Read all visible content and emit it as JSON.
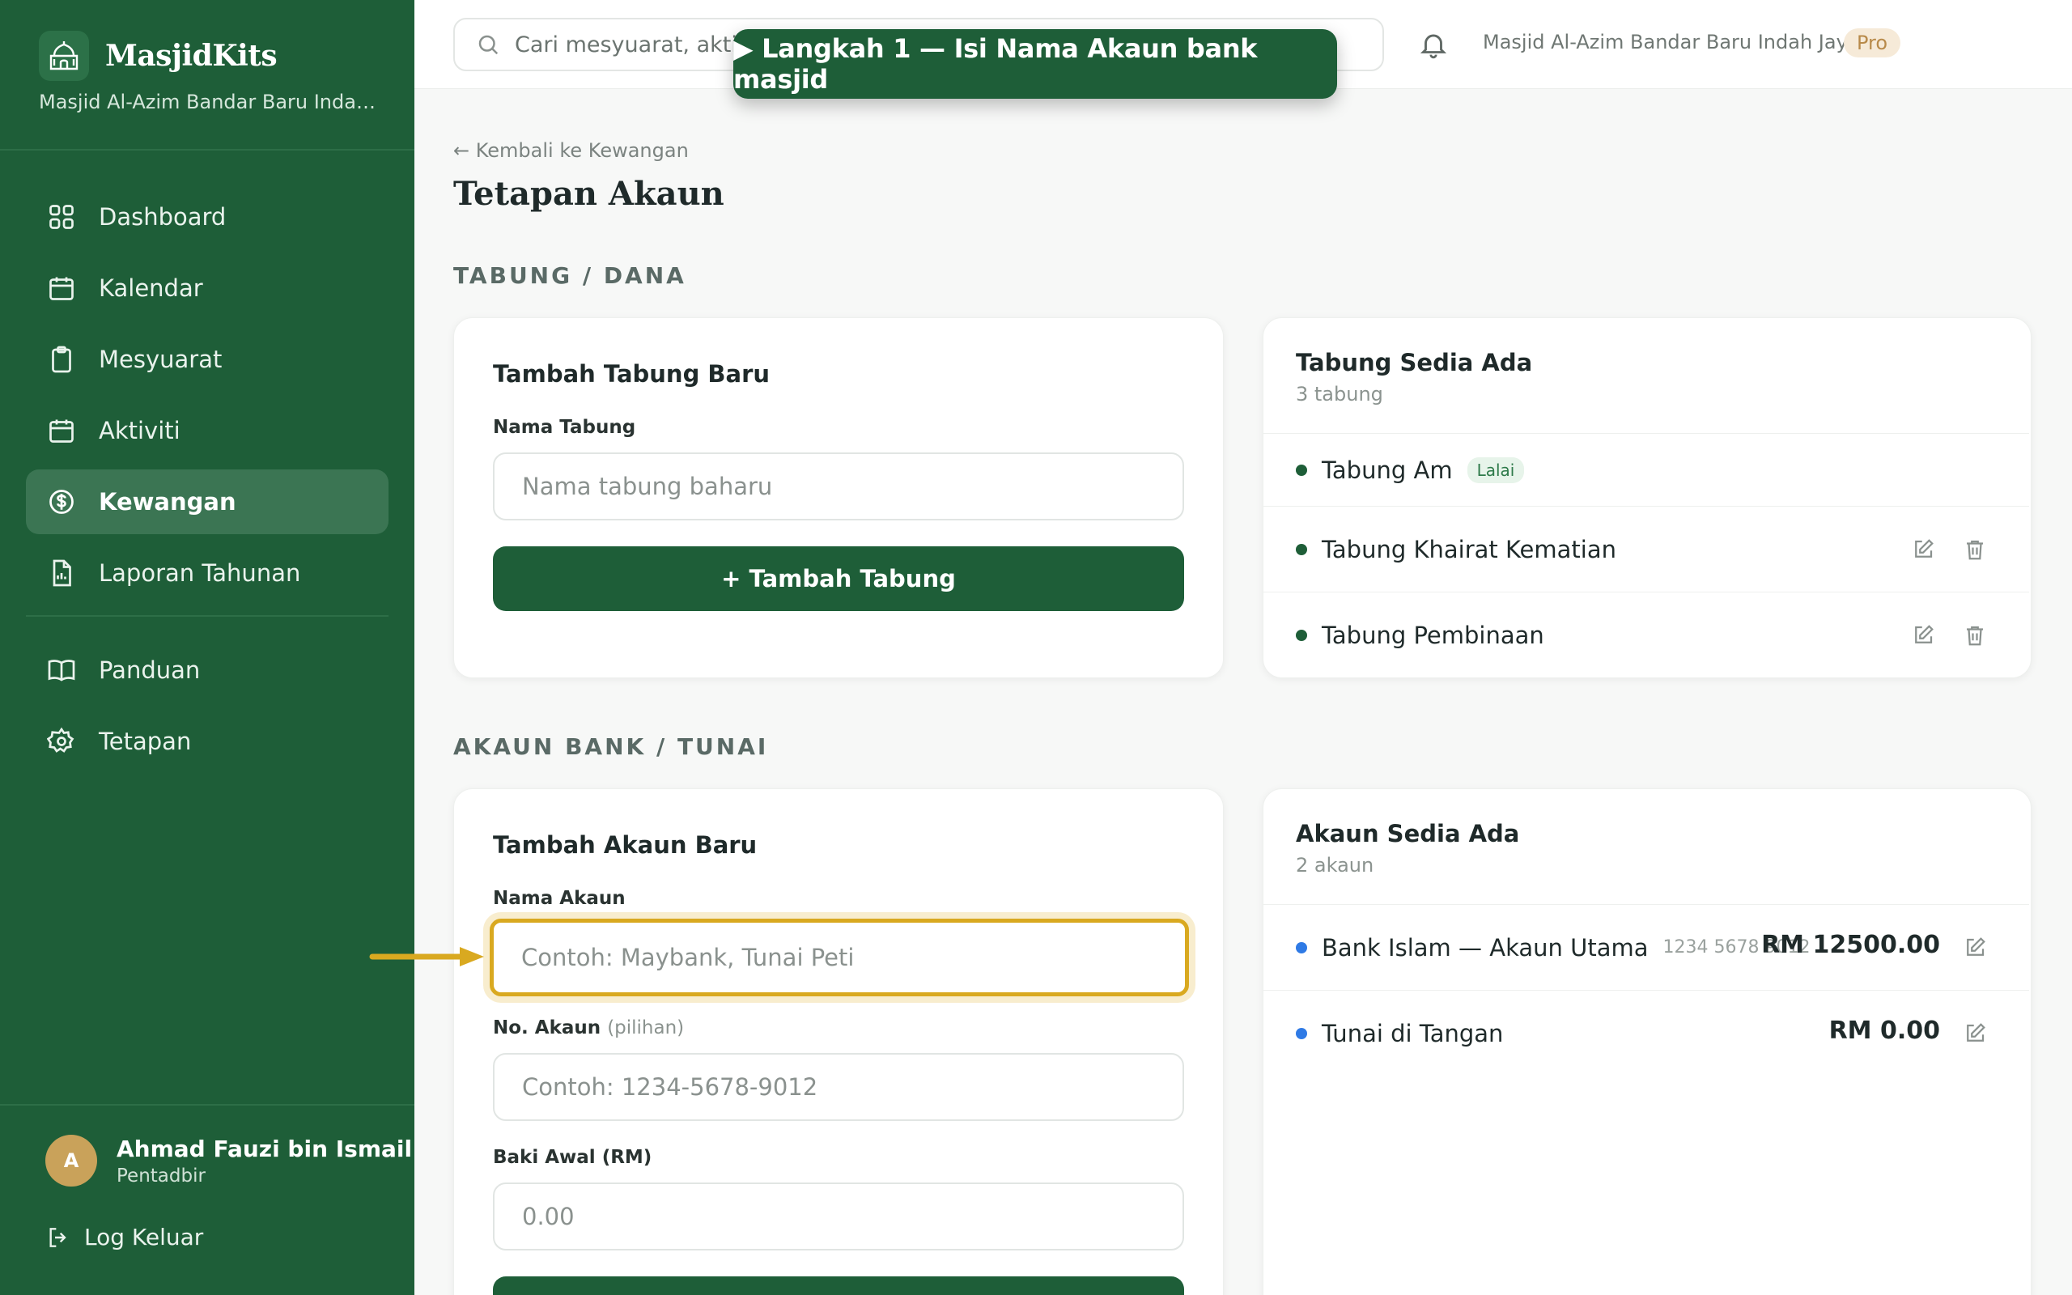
{
  "app": {
    "name": "MasjidKits",
    "mosque_name_short": "Masjid Al-Azim Bandar Baru Indah J...",
    "logo_icon": "mosque-icon",
    "accent": "#1e5e38",
    "highlight": "#d9a920"
  },
  "sidebar": {
    "items": [
      {
        "label": "Dashboard",
        "icon": "grid-icon"
      },
      {
        "label": "Kalendar",
        "icon": "calendar-icon"
      },
      {
        "label": "Mesyuarat",
        "icon": "clipboard-icon"
      },
      {
        "label": "Aktiviti",
        "icon": "calendar-icon"
      },
      {
        "label": "Kewangan",
        "icon": "dollar-icon",
        "active": true
      },
      {
        "label": "Laporan Tahunan",
        "icon": "report-icon"
      },
      {
        "label": "Panduan",
        "icon": "book-icon"
      },
      {
        "label": "Tetapan",
        "icon": "gear-icon"
      }
    ],
    "user": {
      "initial": "A",
      "name": "Ahmad Fauzi bin Ismail",
      "role": "Pentadbir"
    },
    "logout_label": "Log Keluar"
  },
  "topbar": {
    "search_placeholder": "Cari mesyuarat, aktiviti...",
    "mosque_name": "Masjid Al-Azim Bandar Baru Indah Jaya",
    "plan_badge": "Pro"
  },
  "tour": {
    "text": "▶ Langkah 1 — Isi Nama Akaun bank masjid"
  },
  "page": {
    "back_link": "← Kembali ke Kewangan",
    "title": "Tetapan Akaun"
  },
  "funds": {
    "section_title": "TABUNG / DANA",
    "form": {
      "title": "Tambah Tabung Baru",
      "name_label": "Nama Tabung",
      "name_placeholder": "Nama tabung baharu",
      "add_button": "+ Tambah Tabung"
    },
    "list": {
      "title": "Tabung Sedia Ada",
      "count": "3 tabung",
      "items": [
        {
          "name": "Tabung Am",
          "tag": "Lalai",
          "color": "#1e5e38"
        },
        {
          "name": "Tabung Khairat Kematian",
          "color": "#1e5e38"
        },
        {
          "name": "Tabung Pembinaan",
          "color": "#1e5e38"
        }
      ]
    }
  },
  "accounts": {
    "section_title": "AKAUN BANK / TUNAI",
    "form": {
      "title": "Tambah Akaun Baru",
      "name_label": "Nama Akaun",
      "name_placeholder": "Contoh: Maybank, Tunai Peti",
      "number_label": "No. Akaun",
      "number_optional": "(pilihan)",
      "number_placeholder": "Contoh: 1234-5678-9012",
      "balance_label": "Baki Awal (RM)",
      "balance_placeholder": "0.00"
    },
    "list": {
      "title": "Akaun Sedia Ada",
      "count": "2 akaun",
      "items": [
        {
          "name": "Bank Islam — Akaun Utama",
          "number": "1234 5678 9012",
          "amount": "RM 12500.00",
          "color": "#2f7ae5"
        },
        {
          "name": "Tunai di Tangan",
          "number": "",
          "amount": "RM 0.00",
          "color": "#2f7ae5"
        }
      ]
    }
  }
}
